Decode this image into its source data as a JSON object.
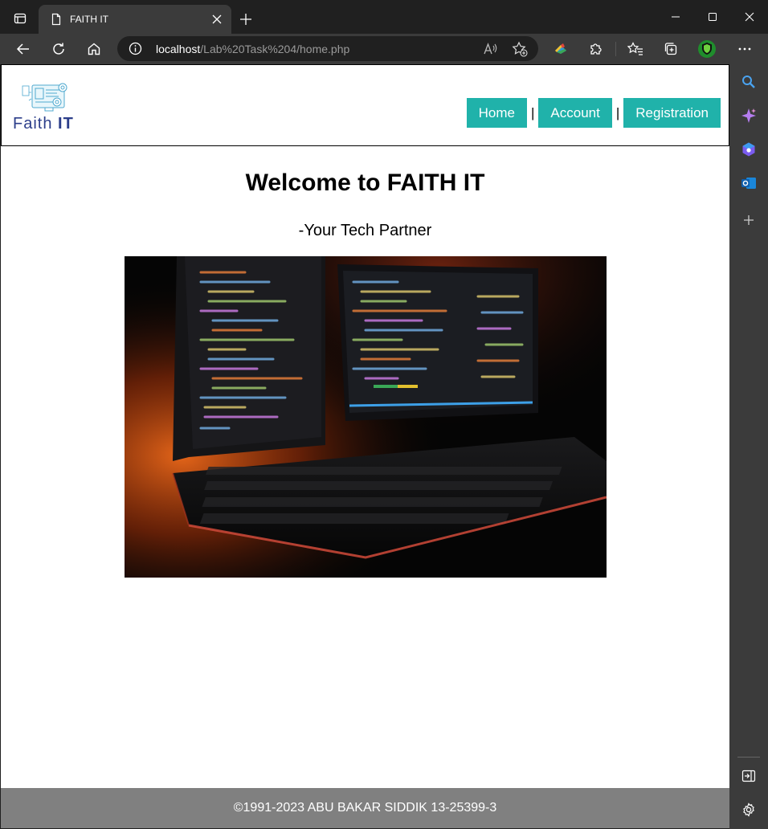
{
  "browser": {
    "tab_title": "FAITH IT",
    "url_host": "localhost",
    "url_path": "/Lab%20Task%204/home.php"
  },
  "site": {
    "logo_text_light": "Faith ",
    "logo_text_bold": "IT",
    "nav": [
      {
        "label": "Home"
      },
      {
        "label": "Account"
      },
      {
        "label": "Registration"
      }
    ],
    "nav_separator": "|",
    "welcome_prefix": "Welcome to ",
    "welcome_brand": "FAITH IT",
    "tagline": "-Your Tech Partner",
    "footer": "©1991-2023 ABU BAKAR SIDDIK 13-25399-3"
  },
  "colors": {
    "nav_button": "#20b2aa",
    "footer_bg": "#808080",
    "browser_chrome": "#3b3b3b"
  },
  "icons": [
    "tab-actions-icon",
    "page-icon",
    "close-icon",
    "plus-icon",
    "minimize-icon",
    "maximize-icon",
    "back-icon",
    "refresh-icon",
    "home-icon",
    "info-icon",
    "read-aloud-icon",
    "favorite-add-icon",
    "extension-colorful-icon",
    "puzzle-icon",
    "favorites-icon",
    "collections-icon",
    "profile-shield-icon",
    "more-icon",
    "search-icon",
    "copilot-icon",
    "games-icon",
    "outlook-icon",
    "hide-sidebar-icon",
    "settings-icon"
  ]
}
